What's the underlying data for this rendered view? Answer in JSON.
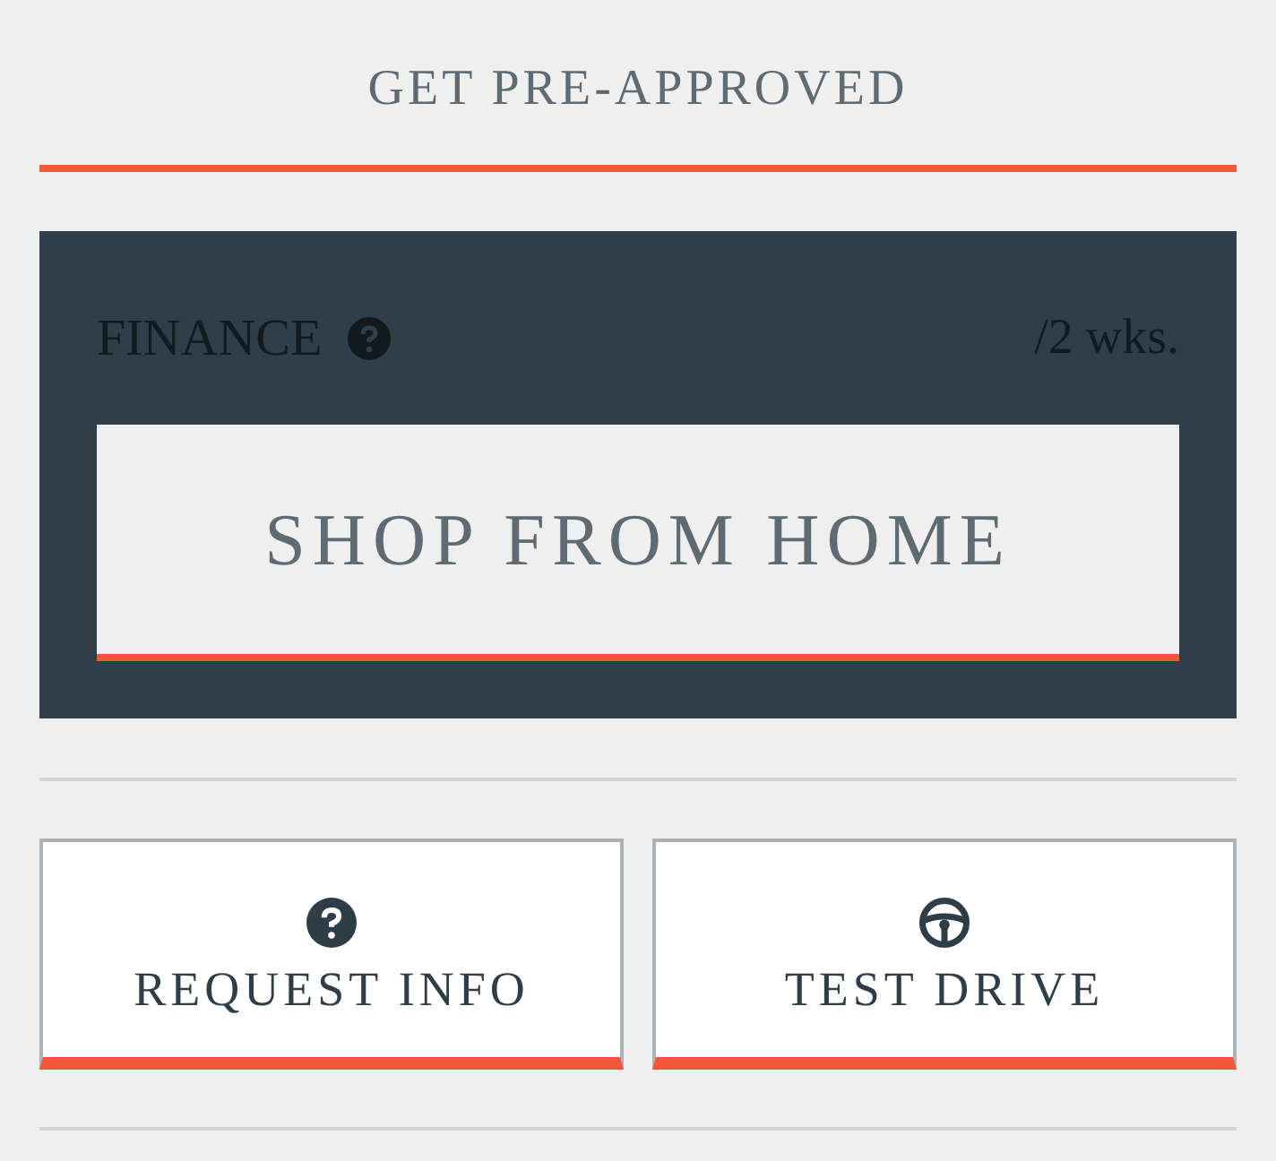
{
  "preapproval_link": "GET PRE-APPROVED",
  "finance": {
    "label": "FINANCE",
    "period": "/2 wks.",
    "button": "SHOP FROM HOME"
  },
  "actions": [
    {
      "kind": "question",
      "label": "REQUEST INFO"
    },
    {
      "kind": "wheel",
      "label": "TEST DRIVE"
    }
  ]
}
